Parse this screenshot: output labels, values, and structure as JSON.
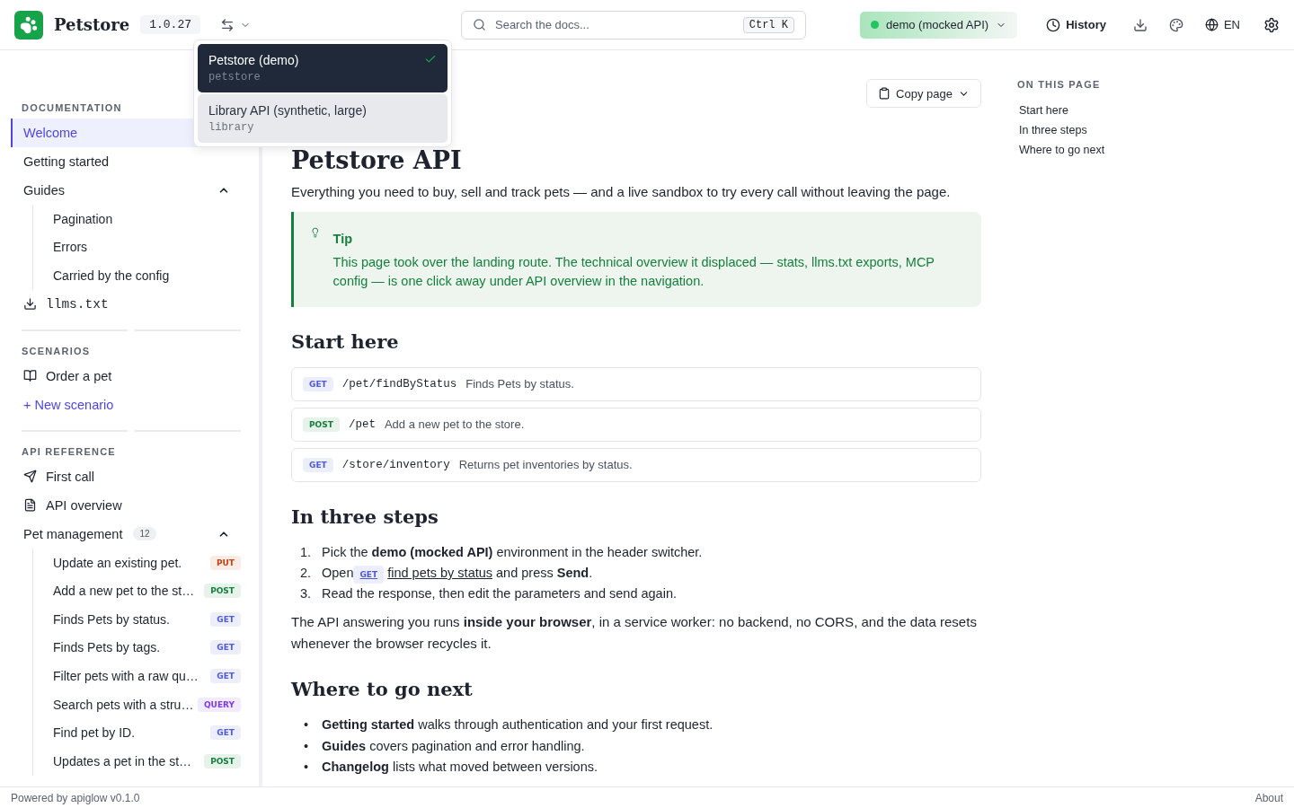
{
  "header": {
    "brand": "Petstore",
    "version": "1.0.27",
    "search": {
      "placeholder": "Search the docs...",
      "shortcut": "Ctrl K"
    },
    "environment": {
      "label": "demo (mocked API)",
      "color": "#22c55e"
    },
    "history": "History",
    "language": "EN"
  },
  "api_menu": {
    "expanded": true,
    "items": [
      {
        "label": "Petstore (demo)",
        "slug": "petstore",
        "selected": true
      },
      {
        "label": "Library API (synthetic, large)",
        "slug": "library",
        "selected": false
      }
    ]
  },
  "sidebar": {
    "sections": [
      {
        "title": "DOCUMENTATION",
        "items": [
          {
            "kind": "link",
            "label": "Welcome",
            "selected": true
          },
          {
            "kind": "link",
            "label": "Getting started",
            "selected": false
          },
          {
            "kind": "group",
            "label": "Guides",
            "expanded": true,
            "children": [
              {
                "label": "Pagination",
                "selected": false
              },
              {
                "label": "Errors",
                "selected": false
              },
              {
                "label": "Carried by the config",
                "selected": false
              }
            ]
          },
          {
            "kind": "download",
            "label": "llms.txt",
            "selected": false
          }
        ]
      },
      {
        "title": "SCENARIOS",
        "items": [
          {
            "kind": "book",
            "label": "Order a pet",
            "selected": false
          },
          {
            "kind": "add",
            "label": "+ New scenario",
            "selected": false
          }
        ]
      },
      {
        "title": "API REFERENCE",
        "items": [
          {
            "kind": "send",
            "label": "First call",
            "selected": false
          },
          {
            "kind": "doc",
            "label": "API overview",
            "selected": false
          },
          {
            "kind": "group",
            "label": "Pet management",
            "count": "12",
            "expanded": true,
            "children": [
              {
                "label": "Update an existing pet.",
                "method": "PUT",
                "color": "#c2410c",
                "selected": false
              },
              {
                "label": "Add a new pet to the st…",
                "method": "POST",
                "color": "#15803d",
                "selected": false
              },
              {
                "label": "Finds Pets by status.",
                "method": "GET",
                "color": "#4f5bd5",
                "selected": false
              },
              {
                "label": "Finds Pets by tags.",
                "method": "GET",
                "color": "#4f5bd5",
                "selected": false
              },
              {
                "label": "Filter pets with a raw qu…",
                "method": "GET",
                "color": "#4f5bd5",
                "selected": false
              },
              {
                "label": "Search pets with a stru…",
                "method": "QUERY",
                "color": "#7c3aed",
                "selected": false
              },
              {
                "label": "Find pet by ID.",
                "method": "GET",
                "color": "#4f5bd5",
                "selected": false
              },
              {
                "label": "Updates a pet in the st…",
                "method": "POST",
                "color": "#15803d",
                "selected": false
              }
            ]
          }
        ]
      }
    ]
  },
  "page": {
    "copy_button": "Copy page",
    "title": "Petstore API",
    "intro": "Everything you need to buy, sell and track pets — and a live sandbox to try every call without leaving the page.",
    "tip": {
      "title": "Tip",
      "text": "This page took over the landing route. The technical overview it displaced — stats, llms.txt exports, MCP config — is one click away under API overview in the navigation."
    },
    "start_heading": "Start here",
    "endpoints": [
      {
        "method": "GET",
        "color": "#4f5bd5",
        "path": "/pet/findByStatus",
        "summary": "Finds Pets by status."
      },
      {
        "method": "POST",
        "color": "#15803d",
        "path": "/pet",
        "summary": "Add a new pet to the store."
      },
      {
        "method": "GET",
        "color": "#4f5bd5",
        "path": "/store/inventory",
        "summary": "Returns pet inventories by status."
      }
    ],
    "steps_heading": "In three steps",
    "steps": [
      {
        "kind": "text",
        "number": "1.",
        "text": "Pick the **demo (mocked API)** environment in the header switcher."
      },
      {
        "kind": "link",
        "number": "2.",
        "before": "Open",
        "method": "GET",
        "color": "#4f5bd5",
        "link": "find pets by status",
        "after": "and press **Send**."
      },
      {
        "kind": "text",
        "number": "3.",
        "text": "Read the response, then edit the parameters and send again."
      }
    ],
    "note": "The API answering you runs **inside your browser**, in a service worker: no backend, no CORS, and the data resets whenever the browser recycles it.",
    "next_heading": "Where to go next",
    "next": [
      {
        "marker": "•",
        "text": "**Getting started** walks through authentication and your first request."
      },
      {
        "marker": "•",
        "text": "**Guides** covers pagination and error handling."
      },
      {
        "marker": "•",
        "text": "**Changelog** lists what moved between versions."
      }
    ]
  },
  "toc": {
    "title": "ON THIS PAGE",
    "items": [
      "Start here",
      "In three steps",
      "Where to go next"
    ]
  },
  "footer": {
    "powered": "Powered by apiglow v0.1.0",
    "about": "About"
  }
}
